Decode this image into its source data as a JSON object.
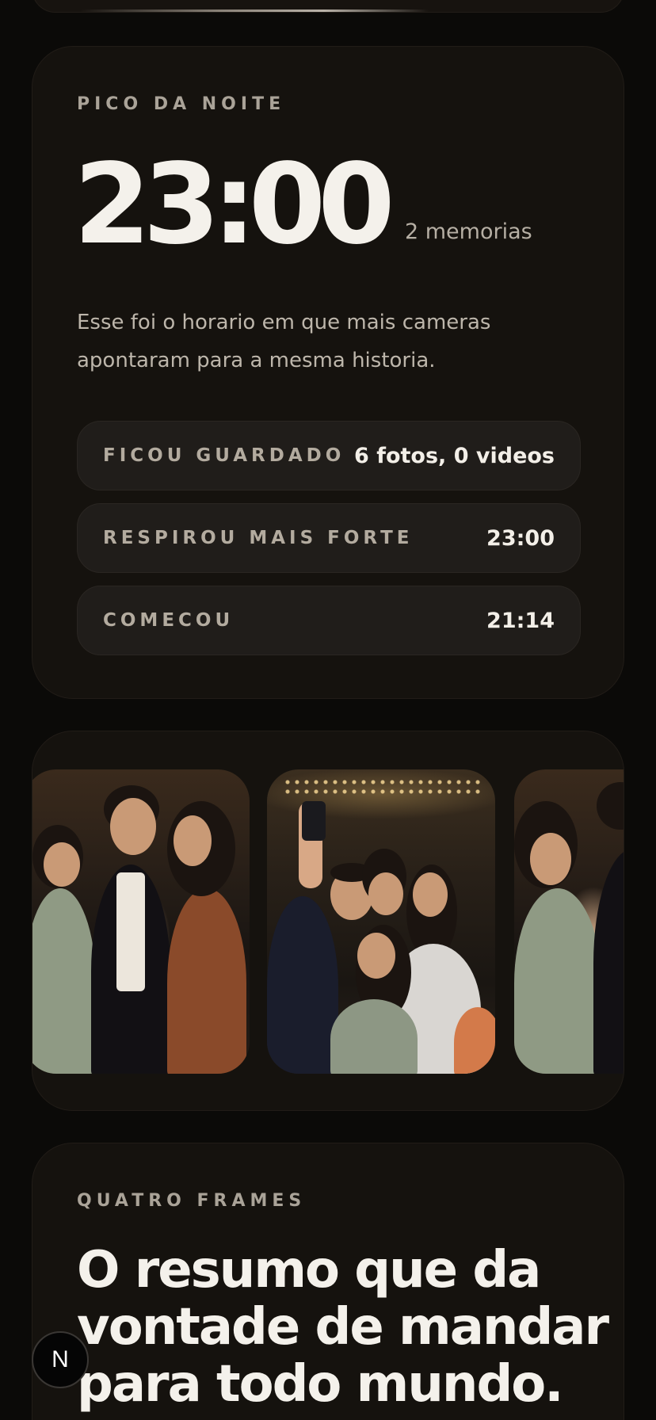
{
  "peak": {
    "eyebrow": "PICO DA NOITE",
    "time": "23:00",
    "memories": "2 memorias",
    "description": "Esse foi o horario em que mais cameras apontaram para a mesma historia.",
    "rows": [
      {
        "label": "FICOU GUARDADO",
        "value": "6 fotos, 0 videos"
      },
      {
        "label": "RESPIROU MAIS FORTE",
        "value": "23:00"
      },
      {
        "label": "COMECOU",
        "value": "21:14"
      }
    ]
  },
  "frames": {
    "eyebrow": "QUATRO FRAMES",
    "headline": "O resumo que da vontade de mandar para todo mundo."
  },
  "fab": {
    "label": "N"
  }
}
